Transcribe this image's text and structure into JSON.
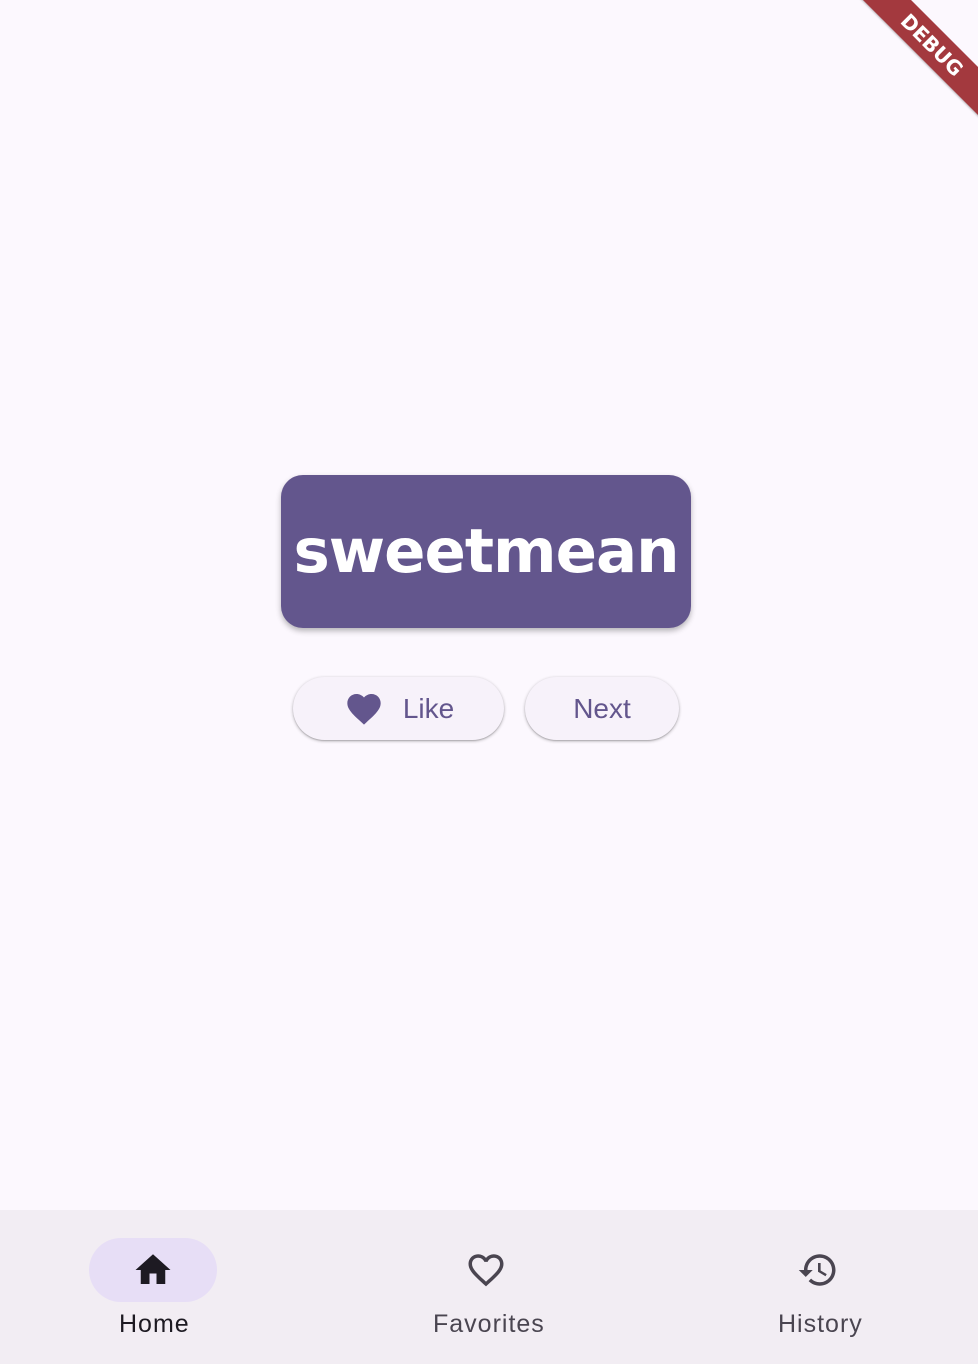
{
  "main": {
    "word": "sweetmean",
    "like_label": "Like",
    "next_label": "Next",
    "like_icon": "heart-filled-icon"
  },
  "bottom_nav": {
    "selected": "Home",
    "items": [
      {
        "label": "Home",
        "icon": "home-icon"
      },
      {
        "label": "Favorites",
        "icon": "heart-outline-icon"
      },
      {
        "label": "History",
        "icon": "history-icon"
      }
    ]
  },
  "debug_banner": {
    "label": "DEBUG"
  },
  "colors": {
    "primary": "#63568d",
    "background": "#fcf8fe",
    "nav_background": "#f2edf3",
    "nav_indicator": "#e7def6",
    "debug_banner": "#a3393e"
  }
}
